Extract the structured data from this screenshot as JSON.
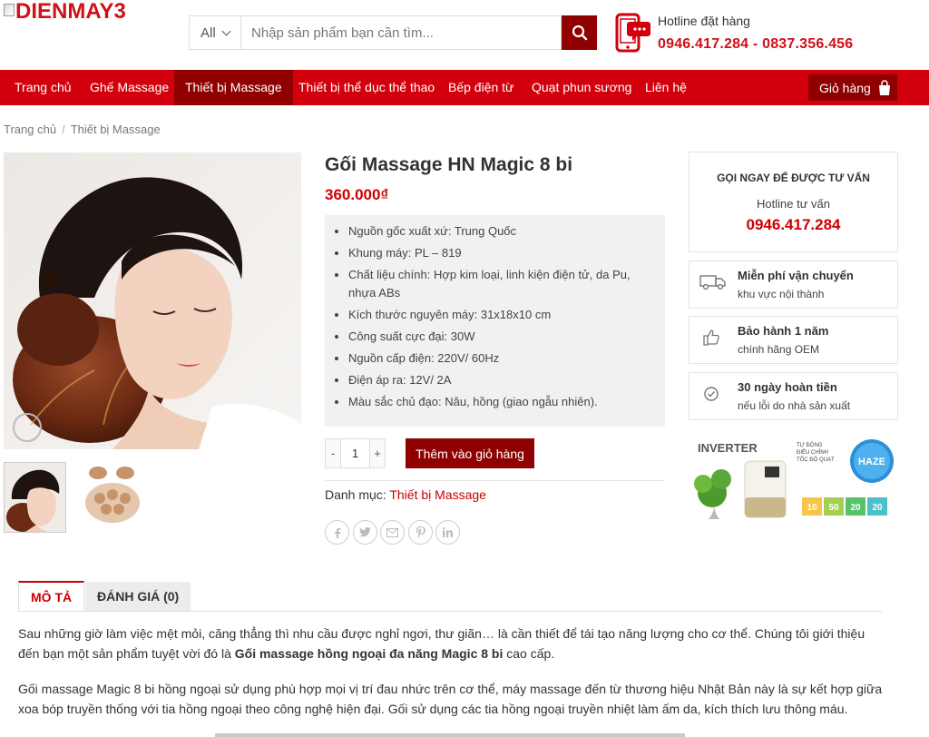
{
  "header": {
    "logo_text": "DIENMAY3",
    "search": {
      "category": "All",
      "placeholder": "Nhập sản phẩm bạn cần tìm..."
    },
    "hotline_label": "Hotline đặt hàng",
    "hotline_numbers": "0946.417.284 - 0837.356.456"
  },
  "nav": {
    "items": [
      {
        "label": "Trang chủ"
      },
      {
        "label": "Ghế Massage"
      },
      {
        "label": "Thiết bị Massage"
      },
      {
        "label": "Thiết bị thể dục thể thao"
      },
      {
        "label": "Bếp điện từ"
      },
      {
        "label": "Quạt phun sương"
      },
      {
        "label": "Liên hệ"
      }
    ],
    "active_index": 2,
    "cart_label": "Giỏ hàng"
  },
  "breadcrumb": [
    "Trang chủ",
    "Thiết bị Massage"
  ],
  "product": {
    "title": "Gối Massage HN Magic 8 bi",
    "price": "360.000₫",
    "specs": [
      "Nguồn gốc xuất xứ: Trung Quốc",
      "Khung máy: PL – 819",
      "Chất liệu chính: Hợp kim loại, linh kiện điện tử, da Pu, nhựa ABs",
      "Kích thước nguyên máy: 31x18x10 cm",
      "Công suất cực đại: 30W",
      "Nguồn cấp điện: 220V/ 60Hz",
      "Điện áp ra: 12V/ 2A",
      "Màu sắc chủ đạo: Nâu, hồng (giao ngẫu nhiên)."
    ],
    "quantity": "1",
    "qty_minus": "-",
    "qty_plus": "+",
    "add_to_cart": "Thêm vào giỏ hàng",
    "category_label": "Danh mục:",
    "category_value": "Thiết bị Massage"
  },
  "sidebar": {
    "consult_title": "GỌI NGAY ĐỂ ĐƯỢC TƯ VẤN",
    "consult_sub": "Hotline tư vấn",
    "consult_number": "0946.417.284",
    "features": [
      {
        "title": "Miễn phí vận chuyển",
        "sub": "khu vực nội thành",
        "icon": "truck-icon"
      },
      {
        "title": "Bảo hành 1 năm",
        "sub": "chính hãng OEM",
        "icon": "thumbs-up-icon"
      },
      {
        "title": "30 ngày hoàn tiền",
        "sub": "nếu lỗi do nhà sản xuất",
        "icon": "check-circle-icon"
      }
    ],
    "banner": {
      "inverter": "INVERTER",
      "haze": "HAZE",
      "line1": "TỰ ĐỘNG",
      "line2": "ĐIỀU CHỈNH",
      "line3": "TỐC ĐỘ QUẠT",
      "modes": [
        "10",
        "50",
        "20",
        "20"
      ]
    }
  },
  "tabs": [
    {
      "label": "MÔ TẢ"
    },
    {
      "label": "ĐÁNH GIÁ (0)"
    }
  ],
  "description": {
    "p1_a": "Sau những giờ làm việc mệt mỏi, căng thẳng thì nhu cầu được nghỉ ngơi, thư giãn… là cần thiết để tái tạo năng lượng cho cơ thể. Chúng tôi giới thiệu đến bạn một sản phẩm tuyệt vời đó là ",
    "p1_bold": "Gối massage hồng ngoại đa năng Magic 8 bi",
    "p1_b": " cao cấp.",
    "p2": "Gối massage Magic 8 bi hồng ngoại sử dụng phù hợp mọi vị trí đau nhức trên cơ thể, máy massage đến từ thương hiệu Nhật Bản này là sự kết hợp giữa xoa bóp truyền thống với tia hồng ngoại theo công nghệ hiện đại. Gối sử dụng các tia hồng ngoại truyền nhiệt làm ấm da, kích thích lưu thông máu."
  },
  "colors": {
    "brand_red": "#d2000c",
    "dark_red": "#8f0000",
    "price_red": "#c00"
  }
}
